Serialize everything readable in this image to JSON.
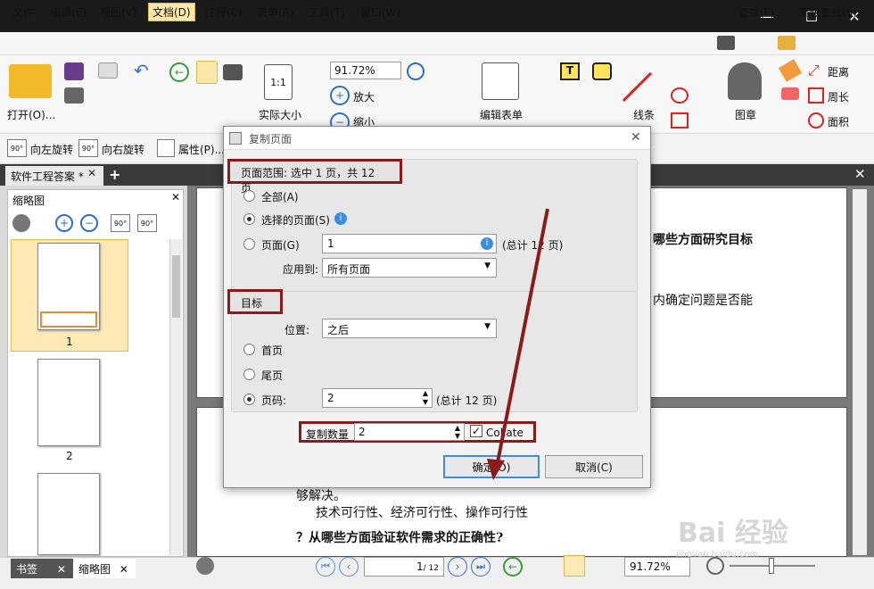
{
  "menu": {
    "items": [
      "文件",
      "编辑(E)",
      "视图(V)",
      "文档(D)",
      "注释(C)",
      "表单(R)",
      "工具(T)",
      "窗口(W)"
    ],
    "active": "文档(D)",
    "right": [
      "查找(F)",
      "高级查找(S)"
    ]
  },
  "ribbon": {
    "open": "打开(O)...",
    "zoom": "91.72%",
    "actual_size": "实际大小",
    "enlarge": "放大",
    "shrink": "缩小",
    "edit_form": "编辑表单",
    "line": "线条",
    "stamp": "图章",
    "distance": "距离",
    "perimeter": "周长",
    "area": "面积"
  },
  "toolbar2": {
    "rotate_left": "向左旋转",
    "rotate_right": "向右旋转",
    "properties": "属性(P)..."
  },
  "tab": {
    "name": "软件工程答案 *"
  },
  "thumbnails": {
    "title": "缩略图",
    "pages": [
      "1",
      "2"
    ]
  },
  "document": {
    "line1": "哪些方面研究目标",
    "line2": "内确定问题是否能",
    "line3": "够解决。",
    "line4": "技术可行性、经济可行性、操作可行性",
    "line5": "？从哪些方面验证软件需求的正确性?"
  },
  "dialog": {
    "title": "复制页面",
    "range_label": "页面范围: 选中 1 页，共 12 页",
    "all": "全部(A)",
    "selected": "选择的页面(S)",
    "pages": "页面(G)",
    "pages_value": "1",
    "total": "(总计 12 页)",
    "apply_to": "应用到:",
    "apply_value": "所有页面",
    "target_label": "目标",
    "position": "位置:",
    "position_value": "之后",
    "first": "首页",
    "last": "尾页",
    "page_no": "页码:",
    "page_no_value": "2",
    "total2": "(总计 12 页)",
    "copies_label": "复制数量",
    "copies_value": "2",
    "collate": "Collate",
    "ok": "确定(O)",
    "cancel": "取消(C)"
  },
  "bottom": {
    "page": "1",
    "page_total": "/ 12",
    "zoom": "91.72%",
    "tab_bookmarks": "书签",
    "tab_thumbs": "缩略图"
  },
  "watermark": "Bai 经验",
  "watermark_url": "jingyan.baidu.com"
}
